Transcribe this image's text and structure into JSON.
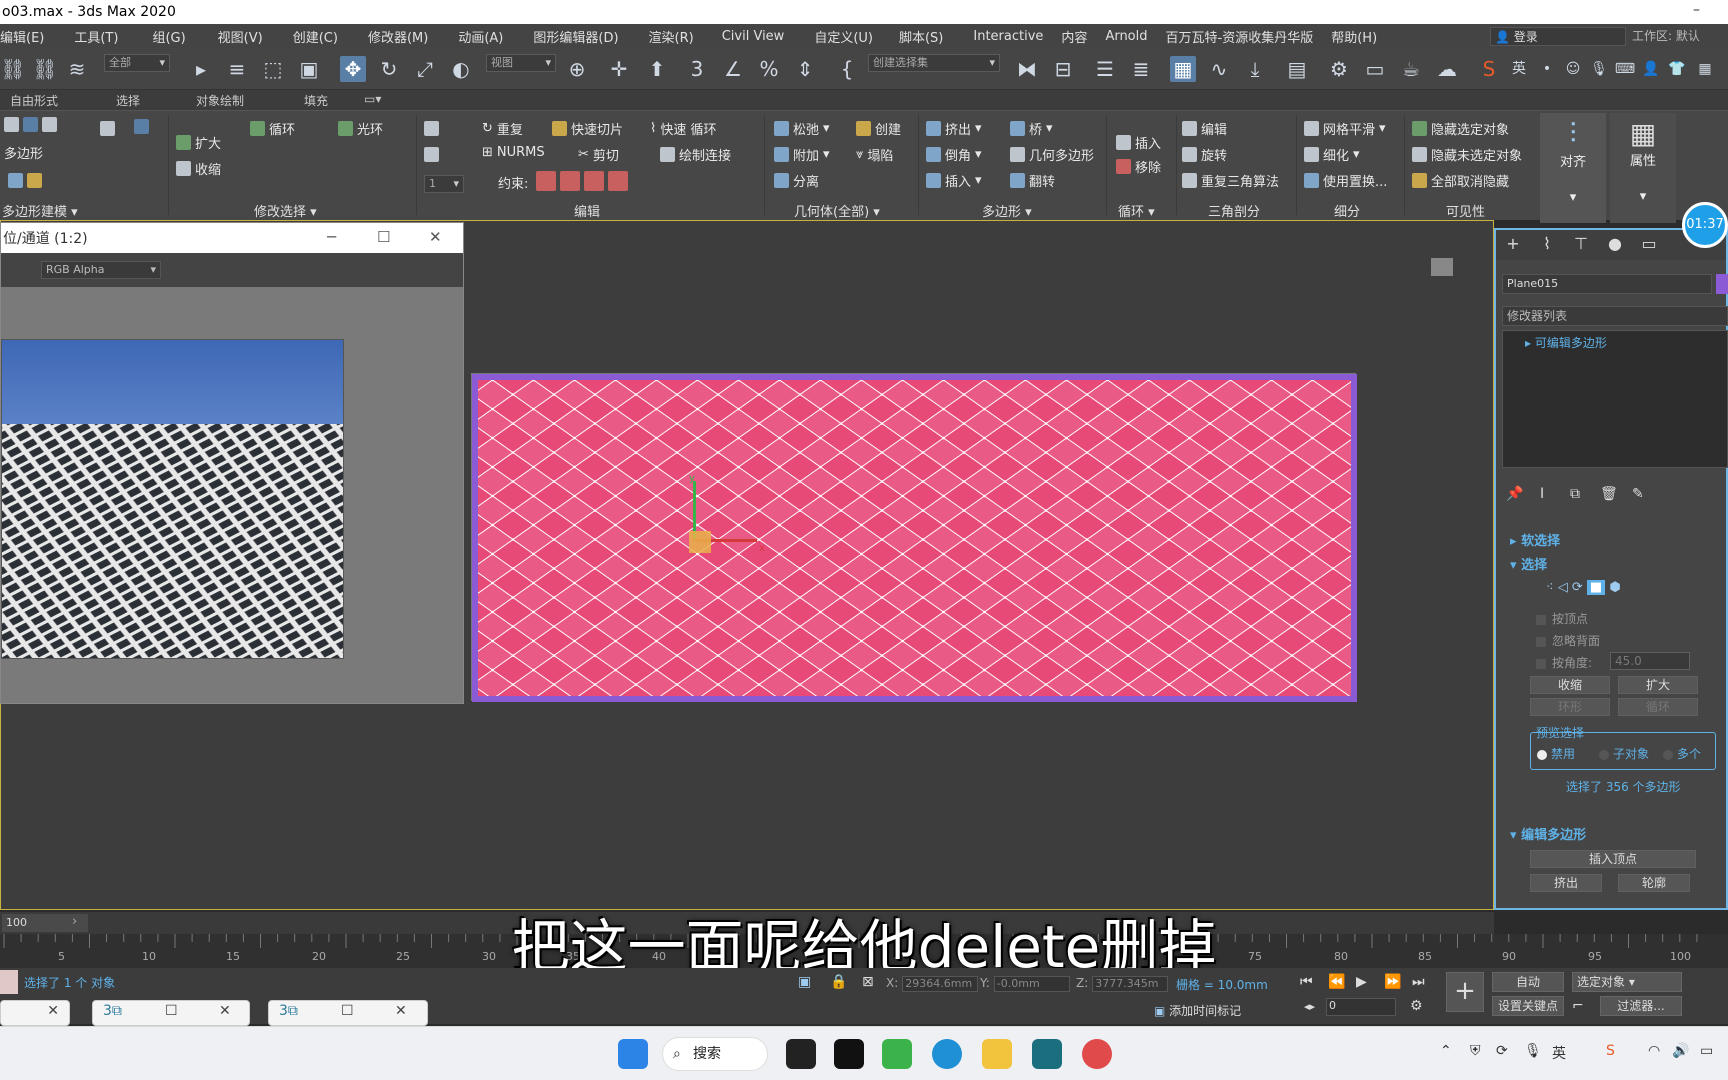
{
  "window": {
    "title": "o03.max - 3ds Max 2020",
    "minimize_glyph": "–"
  },
  "menu": {
    "items": [
      "编辑(E)",
      "工具(T)",
      "组(G)",
      "视图(V)",
      "创建(C)",
      "修改器(M)",
      "动画(A)",
      "图形编辑器(D)",
      "渲染(R)",
      "Civil View",
      "自定义(U)",
      "脚本(S)",
      "Interactive",
      "内容",
      "Arnold",
      "百万瓦特-资源收集丹华版",
      "帮助(H)"
    ],
    "login": "登录",
    "workspace_label": "工作区:",
    "workspace_value": "默认"
  },
  "toolbar": {
    "filter_value": "全部",
    "refcoord_value": "视图",
    "selset_placeholder": "创建选择集"
  },
  "ribbon_tabs": [
    "自由形式",
    "选择",
    "对象绘制",
    "填充"
  ],
  "ribbon": {
    "groups": {
      "poly_modeling": "多边形建模",
      "modify_select": "修改选择",
      "edit": "编辑",
      "geometry_all": "几何体(全部)",
      "polygons": "多边形",
      "loops": "循环",
      "triangulation": "三角剖分",
      "subdivision": "细分",
      "visibility": "可见性"
    },
    "poly_label": "多边形",
    "modsel": [
      "扩大",
      "收缩",
      "循环",
      "光环"
    ],
    "edit": [
      "重复",
      "快速切片",
      "快速 循环",
      "NURMS",
      "剪切",
      "绘制连接",
      "约束:"
    ],
    "geom": [
      "松弛",
      "创建",
      "附加",
      "塌陷",
      "分离"
    ],
    "poly": [
      "挤出",
      "桥",
      "倒角",
      "几何多边形",
      "插入",
      "翻转"
    ],
    "loops": [
      "插入",
      "移除"
    ],
    "tri": [
      "编辑",
      "旋转",
      "重复三角算法"
    ],
    "subdiv": [
      "网格平滑",
      "细化",
      "使用置换..."
    ],
    "vis": [
      "隐藏选定对象",
      "隐藏未选定对象",
      "全部取消隐藏"
    ],
    "align": "对齐",
    "props": "属性",
    "spinner_value": "1"
  },
  "float_window": {
    "title": "位/通道 (1:2)",
    "channel": "RGB Alpha"
  },
  "command_panel": {
    "object_name": "Plane015",
    "object_color": "#8a5bd4",
    "modifier_list": "修改器列表",
    "stack_item": "可编辑多边形",
    "soft_selection": "软选择",
    "selection": "选择",
    "by_vertex": "按顶点",
    "ignore_backfacing": "忽略背面",
    "by_angle": "按角度:",
    "angle_value": "45.0",
    "shrink": "收缩",
    "grow": "扩大",
    "ring": "环形",
    "loop": "循环",
    "preview_selection": "预览选择",
    "preview_opts": [
      "禁用",
      "子对象",
      "多个"
    ],
    "selected_info": "选择了 356 个多边形",
    "edit_polygons": "编辑多边形",
    "insert_vertex": "插入顶点",
    "extrude": "挤出",
    "outline": "轮廓"
  },
  "time_bubble": "01:37",
  "timeline": {
    "frame_label": "100",
    "ticks": [
      "5",
      "10",
      "15",
      "20",
      "25",
      "30",
      "35",
      "40",
      "75",
      "80",
      "85",
      "90",
      "95",
      "100"
    ]
  },
  "subtitle": "把这一面呢给他delete删掉",
  "status": {
    "selected": "选择了 1 个 对象",
    "x_label": "X:",
    "x_value": "29364.6mm",
    "y_label": "Y:",
    "y_value": "-0.0mm",
    "z_label": "Z:",
    "z_value": "3777.345m",
    "grid": "栅格 = 10.0mm",
    "add_time_tag": "添加时间标记",
    "auto": "自动",
    "selected_object": "选定对象",
    "set_key": "设置关键点",
    "filters": "过滤器...",
    "frame_value": "0"
  },
  "taskbar": {
    "search": "搜索"
  }
}
